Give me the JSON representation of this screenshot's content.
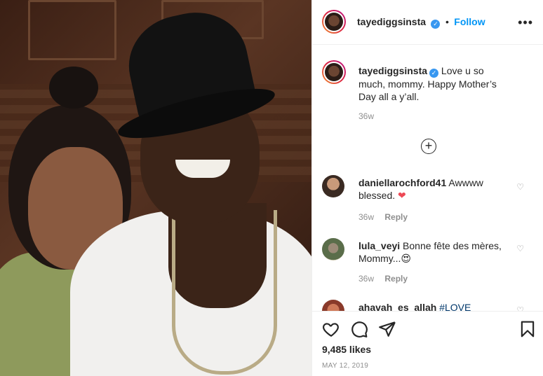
{
  "post": {
    "author": {
      "username": "tayediggsinsta",
      "follow_label": "Follow",
      "separator": "•",
      "verified_icon": "verified-badge-icon"
    },
    "more_icon": "more-options-icon",
    "caption": {
      "username": "tayediggsinsta",
      "text": "Love u so much, mommy. Happy Mother’s Day all a y’all.",
      "time": "36w"
    },
    "load_more_icon": "plus-circle-icon",
    "comments": [
      {
        "username": "daniellarochford41",
        "text": "Awwww blessed.",
        "emoji": "❤",
        "time": "36w",
        "reply_label": "Reply"
      },
      {
        "username": "lula_veyi",
        "text": "Bonne fête des mères, Mommy...",
        "emoji": "😍",
        "time": "36w",
        "reply_label": "Reply"
      },
      {
        "username": "ahavah_es_allah",
        "text": "#LOVE"
      }
    ],
    "likes": "9,485 likes",
    "date": "MAY 12, 2019",
    "colors": {
      "accent": "#0095f6",
      "muted": "#8e8e8e",
      "text": "#262626",
      "heart": "#ed4956"
    }
  }
}
